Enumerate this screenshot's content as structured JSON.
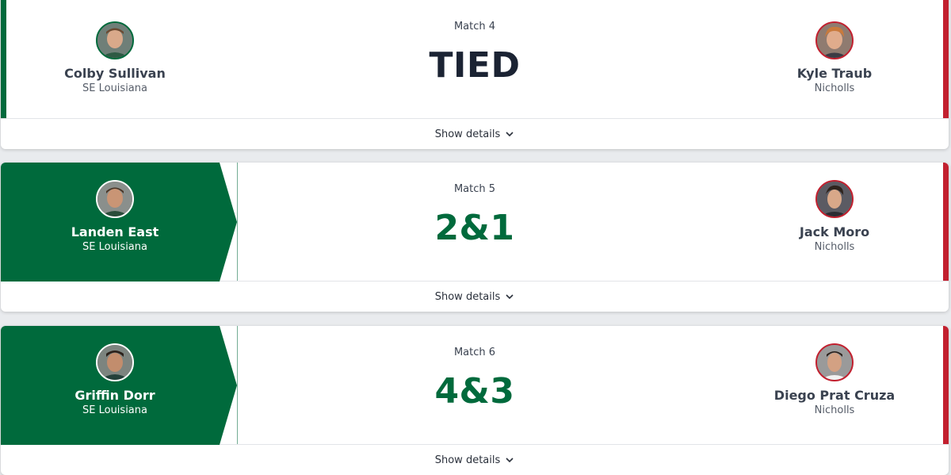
{
  "matches": [
    {
      "label": "Match 4",
      "result": "TIED",
      "home": {
        "name": "Colby Sullivan",
        "team": "SE Louisiana",
        "winner": false
      },
      "away": {
        "name": "Kyle Traub",
        "team": "Nicholls",
        "winner": false
      },
      "details_label": "Show details"
    },
    {
      "label": "Match 5",
      "result": "2&1",
      "home": {
        "name": "Landen East",
        "team": "SE Louisiana",
        "winner": true
      },
      "away": {
        "name": "Jack Moro",
        "team": "Nicholls",
        "winner": false
      },
      "details_label": "Show details"
    },
    {
      "label": "Match 6",
      "result": "4&3",
      "home": {
        "name": "Griffin Dorr",
        "team": "SE Louisiana",
        "winner": true
      },
      "away": {
        "name": "Diego Prat Cruza",
        "team": "Nicholls",
        "winner": false
      },
      "details_label": "Show details"
    }
  ],
  "colors": {
    "home": "#006a3c",
    "away": "#c2202f",
    "text": "#3a4250"
  },
  "icons": {
    "details": "chevron-down-icon",
    "avatar": "player-photo"
  }
}
